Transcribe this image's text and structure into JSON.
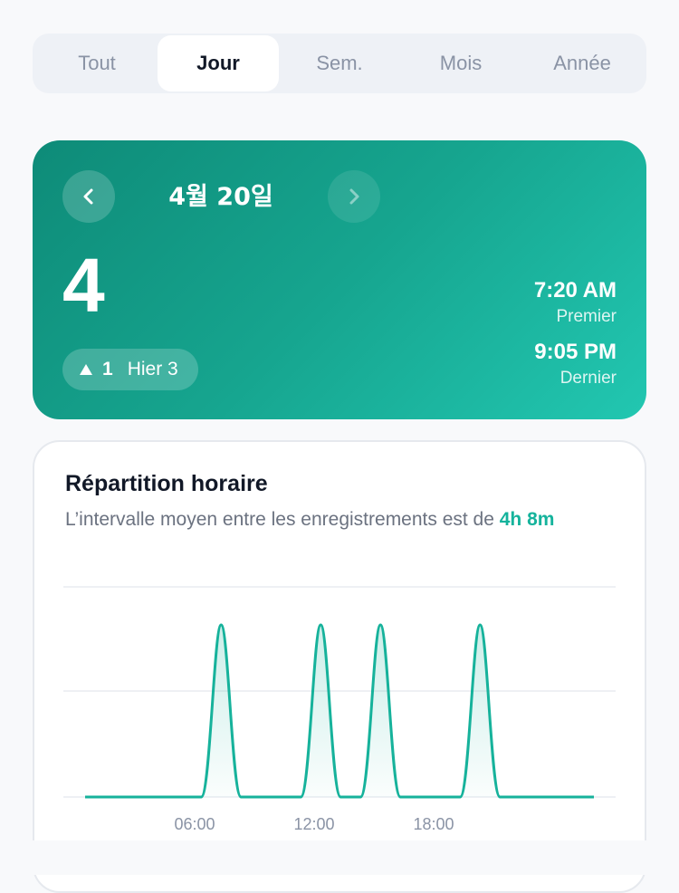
{
  "tabs": [
    {
      "label": "Tout",
      "active": false
    },
    {
      "label": "Jour",
      "active": true
    },
    {
      "label": "Sem.",
      "active": false
    },
    {
      "label": "Mois",
      "active": false
    },
    {
      "label": "Année",
      "active": false
    }
  ],
  "hero": {
    "date": "4월 20일",
    "count": "4",
    "delta": "1",
    "yesterday": "Hier 3",
    "first_time": "7:20 AM",
    "first_label": "Premier",
    "last_time": "9:05 PM",
    "last_label": "Dernier",
    "prev_icon": "chevron-left-icon",
    "next_icon": "chevron-right-icon",
    "gradient": [
      "#0e8b78",
      "#22c7b1"
    ]
  },
  "distribution": {
    "title": "Répartition horaire",
    "subtitle": "L’intervalle moyen entre les enregistrements est de ",
    "interval": "4h 8m",
    "accent": "#15b39c"
  },
  "chart_data": {
    "type": "area",
    "x_range": [
      0,
      24
    ],
    "tick_labels": [
      "06:00",
      "12:00",
      "18:00"
    ],
    "tick_hours": [
      6,
      12,
      18
    ],
    "peaks_hours": [
      7.33,
      12.33,
      15.33,
      20.33
    ],
    "peak_value": 1,
    "y_range": [
      0,
      1
    ],
    "grid": true,
    "line_color": "#16b29b"
  }
}
